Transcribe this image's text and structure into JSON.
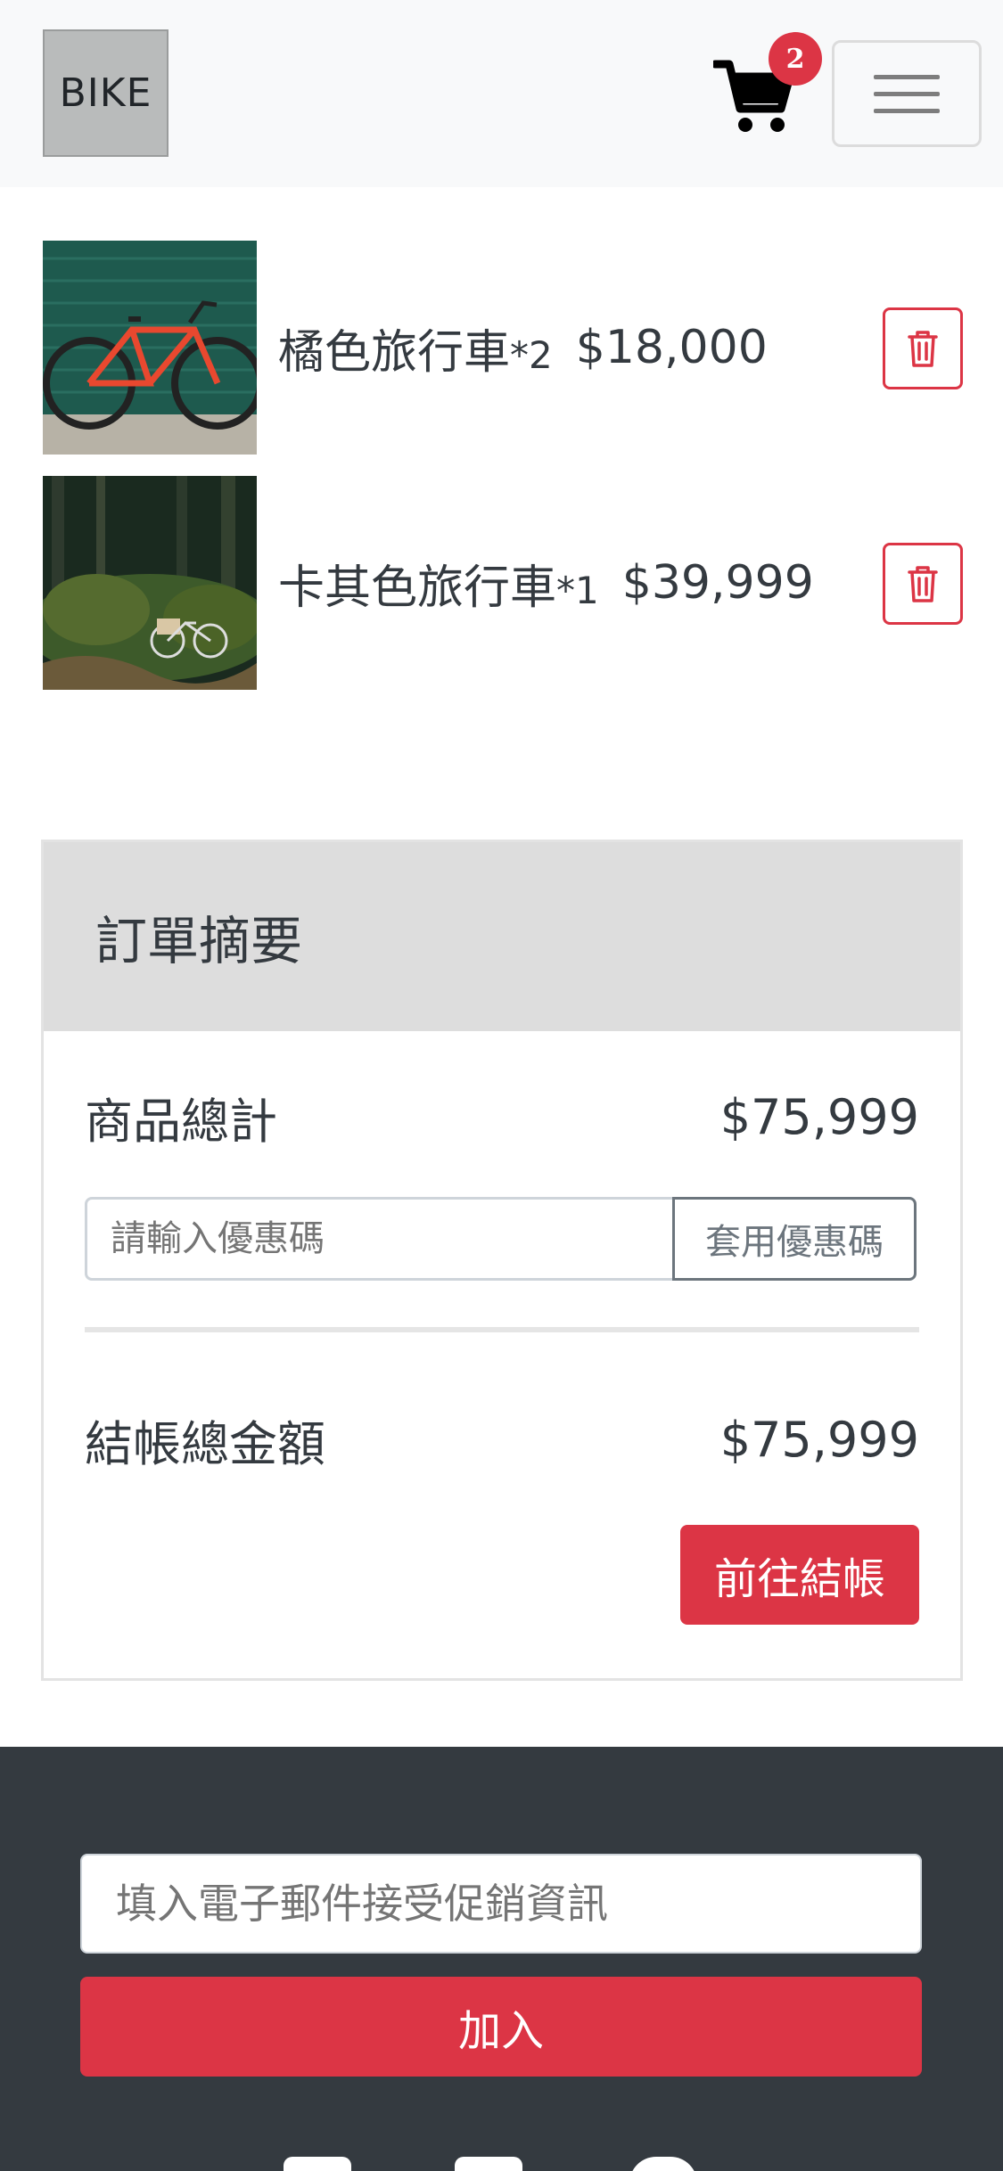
{
  "navbar": {
    "brand": "BIKE",
    "cart_icon": "shopping-cart-icon",
    "cart_count": "2",
    "menu_icon": "hamburger-menu-icon"
  },
  "cart_items": [
    {
      "name": "橘色旅行車",
      "qty": "*2",
      "price": "$18,000",
      "delete_icon": "trash-icon"
    },
    {
      "name": "卡其色旅行車",
      "qty": "*1",
      "price": "$39,999",
      "delete_icon": "trash-icon"
    }
  ],
  "summary": {
    "title": "訂單摘要",
    "subtotal_label": "商品總計",
    "subtotal_value": "$75,999",
    "coupon_placeholder": "請輸入優惠碼",
    "coupon_button": "套用優惠碼",
    "total_label": "結帳總金額",
    "total_value": "$75,999",
    "checkout_button": "前往結帳"
  },
  "footer": {
    "email_placeholder": "填入電子郵件接受促銷資訊",
    "join_button": "加入"
  },
  "colors": {
    "accent": "#dc3545",
    "footer_bg": "#343a40",
    "navbar_bg": "#f8f9fa",
    "summary_header_bg": "#dddddd"
  }
}
